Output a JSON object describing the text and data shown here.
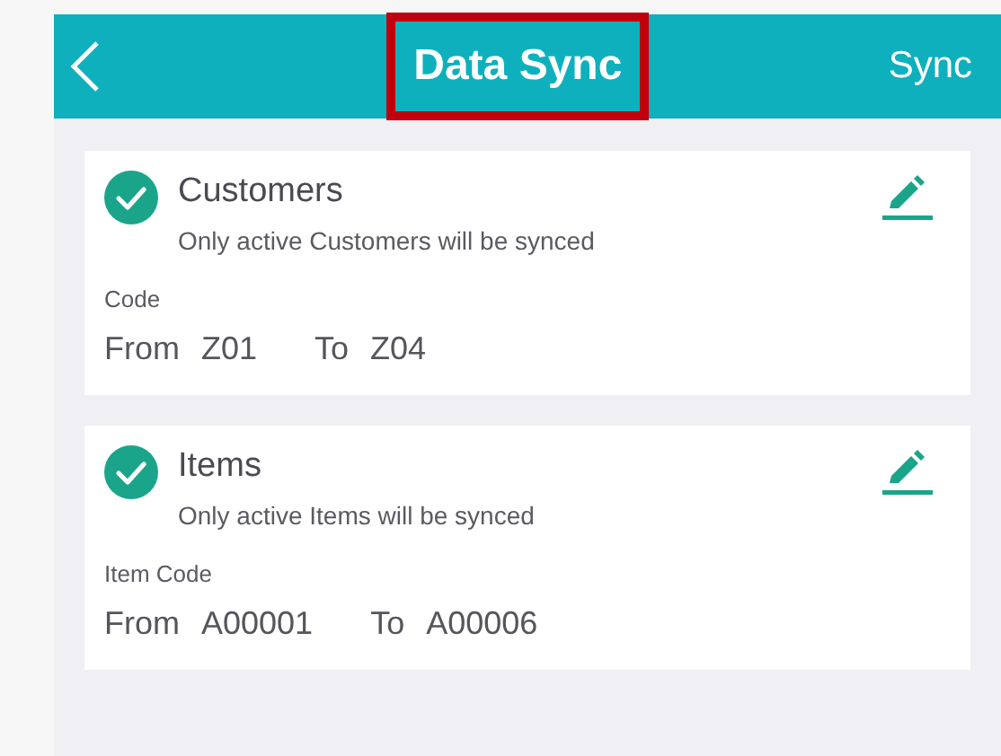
{
  "header": {
    "title": "Data Sync",
    "title_highlighted": true,
    "action": "Sync"
  },
  "sections": [
    {
      "title": "Customers",
      "checked": true,
      "note": "Only active Customers will be synced",
      "field_label": "Code",
      "from_label": "From",
      "from_value": "Z01",
      "to_label": "To",
      "to_value": "Z04"
    },
    {
      "title": "Items",
      "checked": true,
      "note": "Only active Items will be synced",
      "field_label": "Item Code",
      "from_label": "From",
      "from_value": "A00001",
      "to_label": "To",
      "to_value": "A00006"
    }
  ]
}
